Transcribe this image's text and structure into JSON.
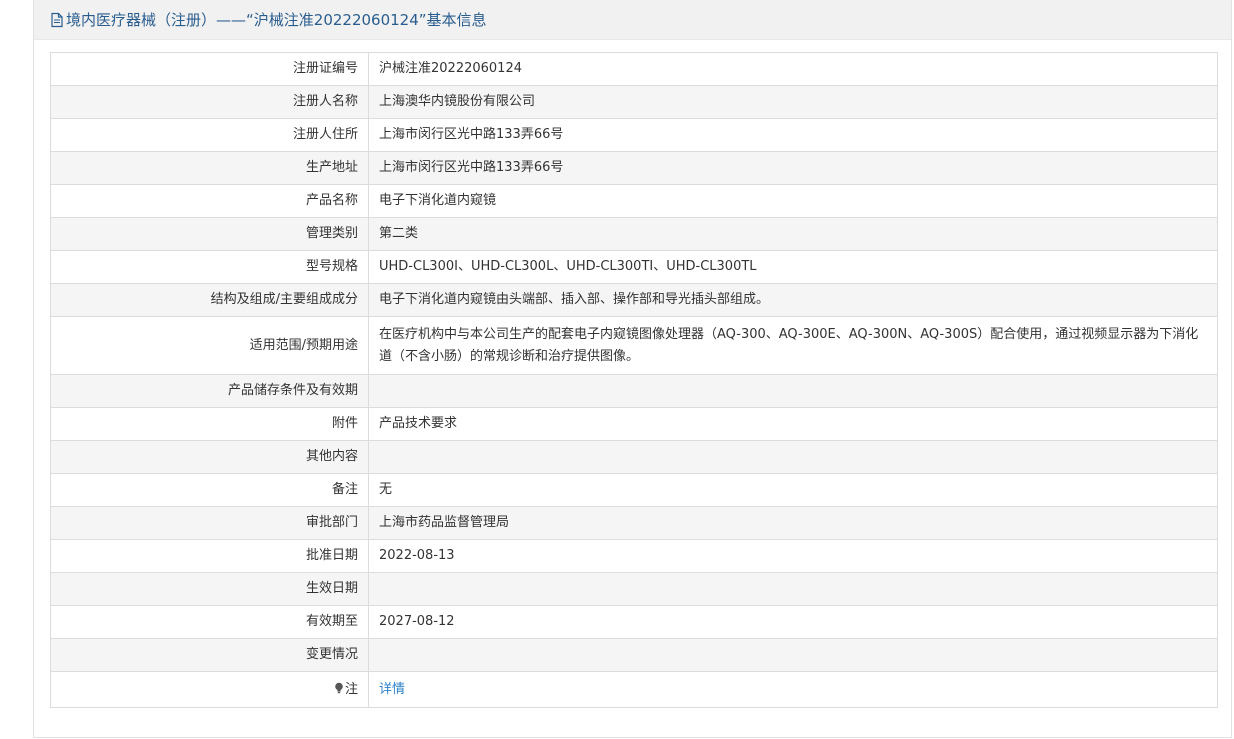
{
  "header": {
    "icon": "document-icon",
    "title": "境内医疗器械（注册）——“沪械注准20222060124”基本信息"
  },
  "rows": [
    {
      "label": "注册证编号",
      "value": "沪械注准20222060124"
    },
    {
      "label": "注册人名称",
      "value": "上海澳华内镜股份有限公司"
    },
    {
      "label": "注册人住所",
      "value": "上海市闵行区光中路133弄66号"
    },
    {
      "label": "生产地址",
      "value": "上海市闵行区光中路133弄66号"
    },
    {
      "label": "产品名称",
      "value": "电子下消化道内窥镜"
    },
    {
      "label": "管理类别",
      "value": "第二类"
    },
    {
      "label": "型号规格",
      "value": "UHD-CL300I、UHD-CL300L、UHD-CL300TI、UHD-CL300TL"
    },
    {
      "label": "结构及组成/主要组成成分",
      "value": "电子下消化道内窥镜由头端部、插入部、操作部和导光插头部组成。"
    },
    {
      "label": "适用范围/预期用途",
      "value": "在医疗机构中与本公司生产的配套电子内窥镜图像处理器（AQ-300、AQ-300E、AQ-300N、AQ-300S）配合使用，通过视频显示器为下消化道（不含小肠）的常规诊断和治疗提供图像。"
    },
    {
      "label": "产品储存条件及有效期",
      "value": ""
    },
    {
      "label": "附件",
      "value": "产品技术要求"
    },
    {
      "label": "其他内容",
      "value": ""
    },
    {
      "label": "备注",
      "value": "无"
    },
    {
      "label": "审批部门",
      "value": "上海市药品监督管理局"
    },
    {
      "label": "批准日期",
      "value": "2022-08-13"
    },
    {
      "label": "生效日期",
      "value": ""
    },
    {
      "label": "有效期至",
      "value": "2027-08-12"
    },
    {
      "label": "变更情况",
      "value": ""
    }
  ],
  "note_row": {
    "icon": "lightbulb-icon",
    "label": "注",
    "link_text": "详情",
    "link_color": "#2e7fc9"
  },
  "colors": {
    "header_text": "#2a5d8f",
    "header_bg": "#f1f1f1",
    "alt_row_bg": "#f5f5f5",
    "border": "#dcdcdc"
  }
}
